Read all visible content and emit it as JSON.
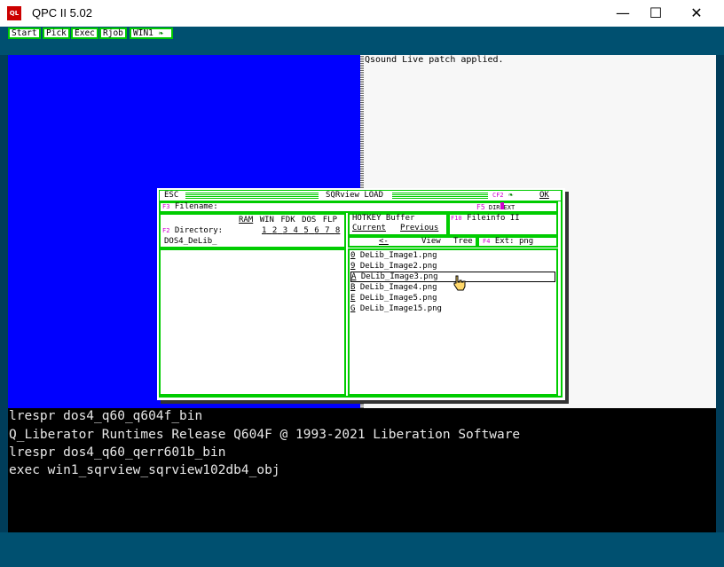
{
  "window": {
    "title": "QPC II 5.02",
    "minimize_glyph": "—",
    "maximize_glyph": "☐",
    "close_glyph": "✕"
  },
  "menubar": {
    "items": [
      "Start",
      "Pick",
      "Exec",
      "Rjob",
      "WIN1"
    ]
  },
  "status_message": "Qsound Live patch applied.",
  "dialog": {
    "esc_label": "ESC",
    "title": "SQRview LOAD",
    "cf2_label": "CF2",
    "ok_label": "OK",
    "f3_key": "F3",
    "filename_label": "Filename:",
    "f5_key": "F5",
    "dir_label": "DIR",
    "ext_label": "EXT",
    "devices": [
      "RAM",
      "WIN",
      "FDK",
      "DOS",
      "FLP"
    ],
    "drive_numbers": [
      "1",
      "2",
      "3",
      "4",
      "5",
      "6",
      "7",
      "8"
    ],
    "f2_key": "F2",
    "directory_label": "Directory:",
    "directory_value": "DOS4_DeLib_",
    "hotkey_buffer_label": "HOTKEY Buffer",
    "current_label": "Current",
    "previous_label": "Previous",
    "f10_key": "F10",
    "fileinfo_label": "Fileinfo II",
    "back_label": "<-",
    "view_label": "View",
    "tree_label": "Tree",
    "f4_key": "F4",
    "ext_filter_label": "Ext: png",
    "files": [
      {
        "key": "0",
        "name": "DeLib_Image1.png"
      },
      {
        "key": "9",
        "name": "DeLib_Image2.png"
      },
      {
        "key": "A",
        "name": "DeLib_Image3.png"
      },
      {
        "key": "B",
        "name": "DeLib_Image4.png"
      },
      {
        "key": "E",
        "name": "DeLib_Image5.png"
      },
      {
        "key": "G",
        "name": "DeLib_Image15.png"
      }
    ],
    "selected_index": 2
  },
  "console": {
    "lines": [
      "lrespr dos4_q60_q604f_bin",
      "Q_Liberator Runtimes Release Q604F @ 1993-2021 Liberation Software",
      "lrespr dos4_q60_qerr601b_bin",
      "exec win1_sqrview_sqrview102db4_obj"
    ]
  },
  "colors": {
    "accent_green": "#00cc00",
    "pane_blue": "#0000ff",
    "fkey_magenta": "#d000d0",
    "desktop_teal": "#005070"
  }
}
